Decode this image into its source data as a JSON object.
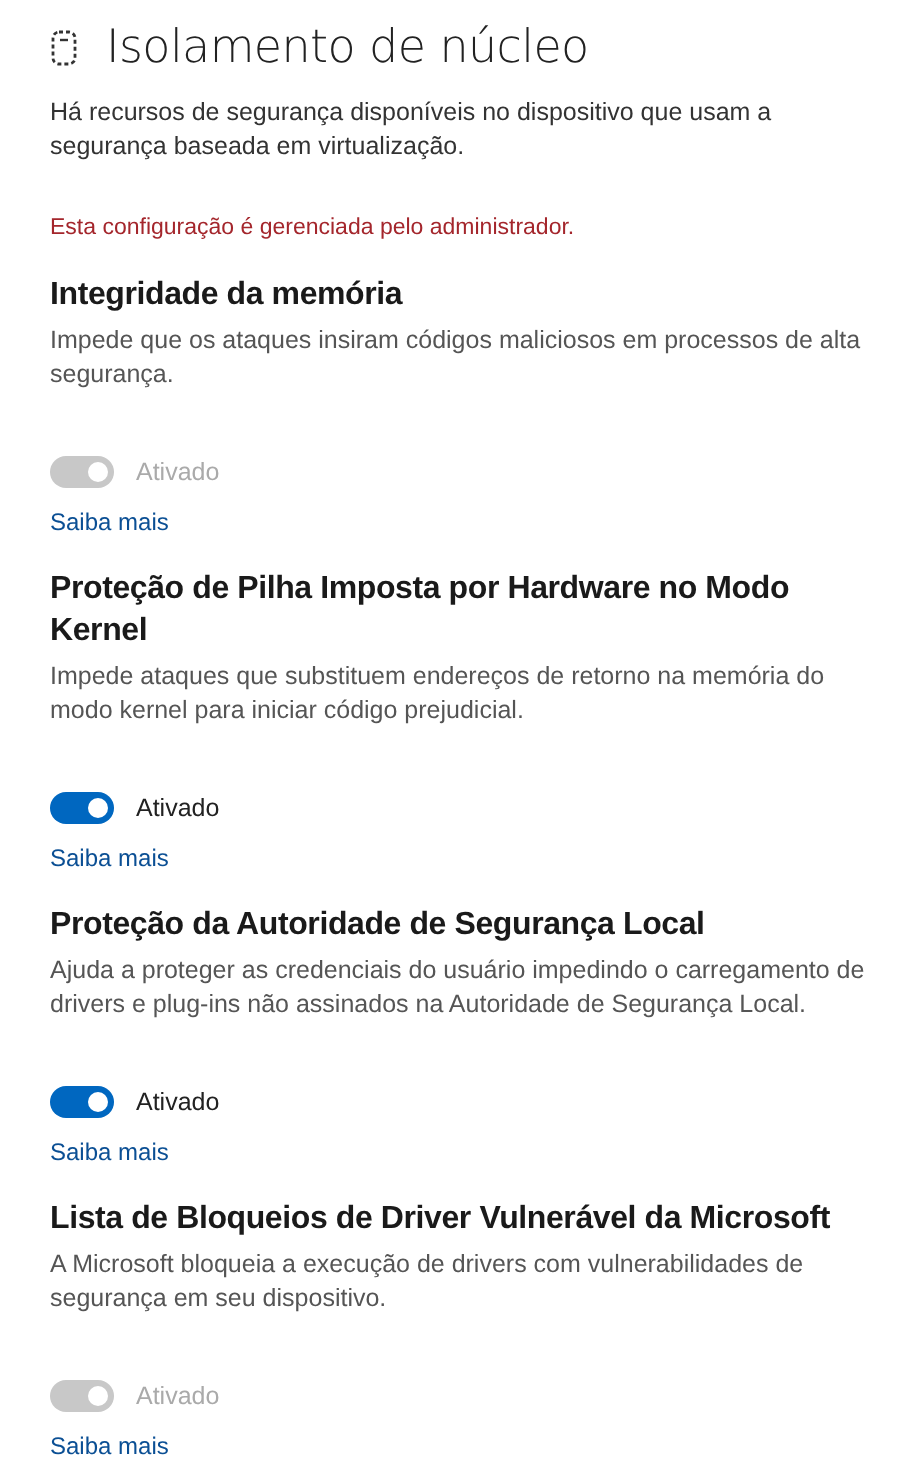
{
  "header": {
    "title": "Isolamento de núcleo",
    "description": "Há recursos de segurança disponíveis no dispositivo que usam a segurança baseada em virtualização.",
    "notice": "Esta configuração é gerenciada pelo administrador."
  },
  "features": [
    {
      "title": "Integridade da memória",
      "description": "Impede que os ataques insiram códigos maliciosos em processos de alta segurança.",
      "toggle": {
        "on": true,
        "disabled": true,
        "label": "Ativado"
      },
      "link": "Saiba mais"
    },
    {
      "title": "Proteção de Pilha Imposta por Hardware no Modo Kernel",
      "description": "Impede ataques que substituem endereços de retorno na memória do modo kernel para iniciar código prejudicial.",
      "toggle": {
        "on": true,
        "disabled": false,
        "label": "Ativado"
      },
      "link": "Saiba mais"
    },
    {
      "title": "Proteção da Autoridade de Segurança Local",
      "description": "Ajuda a proteger as credenciais do usuário impedindo o carregamento de drivers e plug-ins não assinados na Autoridade de Segurança Local.",
      "toggle": {
        "on": true,
        "disabled": false,
        "label": "Ativado"
      },
      "link": "Saiba mais"
    },
    {
      "title": "Lista de Bloqueios de Driver Vulnerável da Microsoft",
      "description": "A Microsoft bloqueia a execução de drivers com vulnerabilidades de segurança em seu dispositivo.",
      "toggle": {
        "on": true,
        "disabled": true,
        "label": "Ativado"
      },
      "link": "Saiba mais"
    }
  ]
}
